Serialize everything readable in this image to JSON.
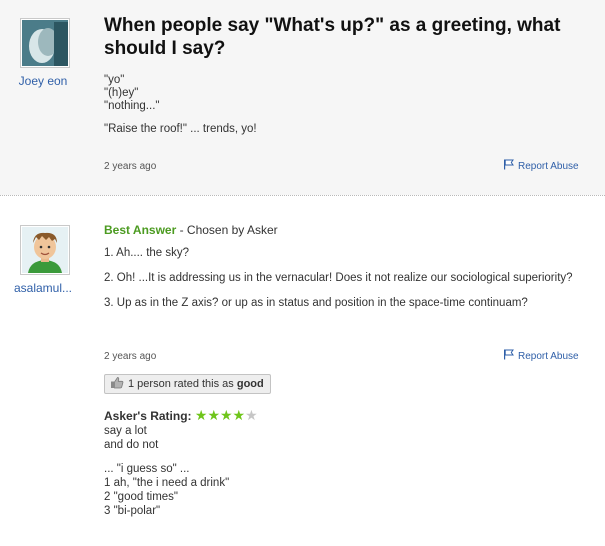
{
  "question": {
    "asker_name": "Joey eon",
    "title": "When people say \"What's up?\" as a greeting, what should I say?",
    "body_lines": [
      "\"yo\"",
      "\"(h)ey\"",
      "\"nothing...\""
    ],
    "extra_line": "\"Raise the roof!\" ... trends, yo!",
    "time_ago": "2 years ago",
    "report_label": "Report Abuse"
  },
  "answer": {
    "answerer_name": "asalamul...",
    "best_label": "Best Answer",
    "chosen_by": " - Chosen by Asker",
    "points": [
      "1. Ah.... the sky?",
      "2. Oh! ...It is addressing us in the vernacular! Does it not realize our sociological superiority?",
      "3. Up as in the Z axis? or up as in status and position in the space-time continuam?"
    ],
    "time_ago": "2 years ago",
    "report_label": "Report Abuse",
    "rated_prefix": "1 person rated this as ",
    "rated_value": "good",
    "askers_rating_label": "Asker's Rating:",
    "stars_on": "★★★★",
    "stars_off": "★",
    "rating_value": 4,
    "rating_max": 5,
    "comment_lines_1": [
      "say a lot",
      "and do not"
    ],
    "comment_lines_2": [
      "... \"i guess so\" ...",
      "1 ah, \"the i need a drink\"",
      "2 \"good times\"",
      "3 \"bi-polar\""
    ]
  },
  "colors": {
    "best_answer": "#4c9b21",
    "link": "#2f5fa8",
    "stars": "#6fc51a",
    "question_bg": "#f6f6f6"
  },
  "icons": [
    "flag-icon",
    "thumbs-up-icon",
    "star-icon"
  ]
}
